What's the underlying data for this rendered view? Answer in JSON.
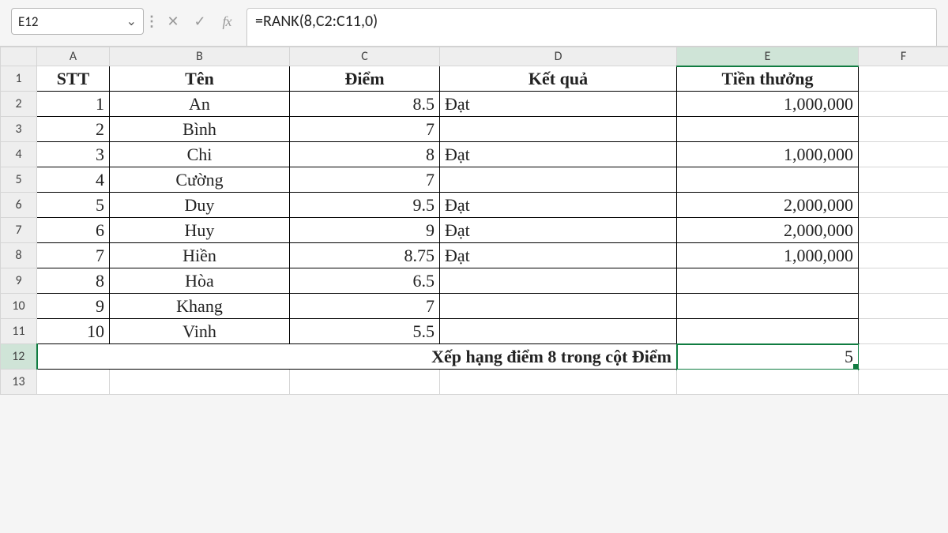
{
  "formula_bar": {
    "cell_ref": "E12",
    "formula": "=RANK(8,C2:C11,0)",
    "fx_label": "fx"
  },
  "columns": [
    "A",
    "B",
    "C",
    "D",
    "E",
    "F"
  ],
  "selected_column": "E",
  "selected_row": "12",
  "headers": {
    "A": "STT",
    "B": "Tên",
    "C": "Điểm",
    "D": "Kết quả",
    "E": "Tiền thưởng"
  },
  "rows": [
    {
      "n": "1",
      "stt": "1",
      "ten": "An",
      "diem": "8.5",
      "kq": "Đạt",
      "tt": "1,000,000"
    },
    {
      "n": "2",
      "stt": "2",
      "ten": "Bình",
      "diem": "7",
      "kq": "",
      "tt": ""
    },
    {
      "n": "3",
      "stt": "3",
      "ten": "Chi",
      "diem": "8",
      "kq": "Đạt",
      "tt": "1,000,000"
    },
    {
      "n": "4",
      "stt": "4",
      "ten": "Cường",
      "diem": "7",
      "kq": "",
      "tt": ""
    },
    {
      "n": "5",
      "stt": "5",
      "ten": "Duy",
      "diem": "9.5",
      "kq": "Đạt",
      "tt": "2,000,000"
    },
    {
      "n": "6",
      "stt": "6",
      "ten": "Huy",
      "diem": "9",
      "kq": "Đạt",
      "tt": "2,000,000"
    },
    {
      "n": "7",
      "stt": "7",
      "ten": "Hiền",
      "diem": "8.75",
      "kq": "Đạt",
      "tt": "1,000,000"
    },
    {
      "n": "8",
      "stt": "8",
      "ten": "Hòa",
      "diem": "6.5",
      "kq": "",
      "tt": ""
    },
    {
      "n": "9",
      "stt": "9",
      "ten": "Khang",
      "diem": "7",
      "kq": "",
      "tt": ""
    },
    {
      "n": "10",
      "stt": "10",
      "ten": "Vinh",
      "diem": "5.5",
      "kq": "",
      "tt": ""
    }
  ],
  "footer": {
    "label": "Xếp hạng điểm 8 trong cột Điểm",
    "value": "5",
    "rownum": "12"
  },
  "extra_row": "13"
}
